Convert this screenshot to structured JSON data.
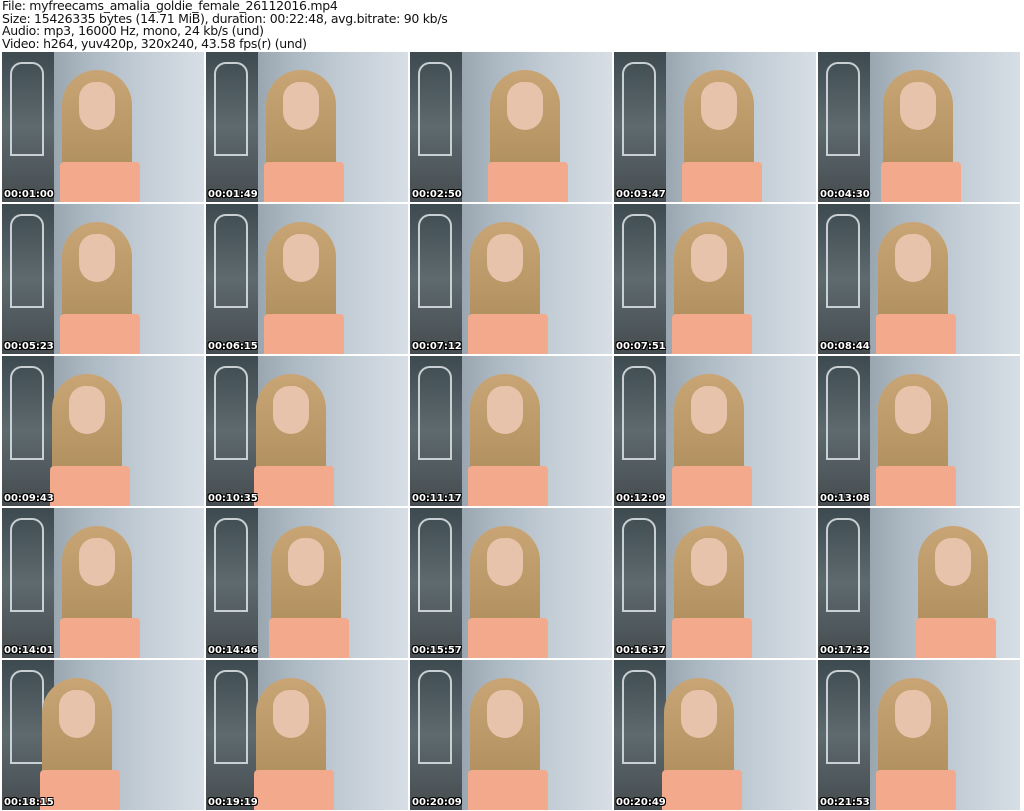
{
  "header": {
    "file": "File: myfreecams_amalia_goldie_female_26112016.mp4",
    "size": "Size: 15426335 bytes (14.71 MiB), duration: 00:22:48, avg.bitrate: 90 kb/s",
    "audio": "Audio: mp3, 16000 Hz, mono, 24 kb/s (und)",
    "video": "Video: h264, yuv420p, 320x240, 43.58 fps(r) (und)"
  },
  "timestamps": [
    "00:01:00",
    "00:01:49",
    "00:02:50",
    "00:03:47",
    "00:04:30",
    "00:05:23",
    "00:06:15",
    "00:07:12",
    "00:07:51",
    "00:08:44",
    "00:09:43",
    "00:10:35",
    "00:11:17",
    "00:12:09",
    "00:13:08",
    "00:14:01",
    "00:14:46",
    "00:15:57",
    "00:16:37",
    "00:17:32",
    "00:18:15",
    "00:19:19",
    "00:20:09",
    "00:20:49",
    "00:21:53"
  ]
}
